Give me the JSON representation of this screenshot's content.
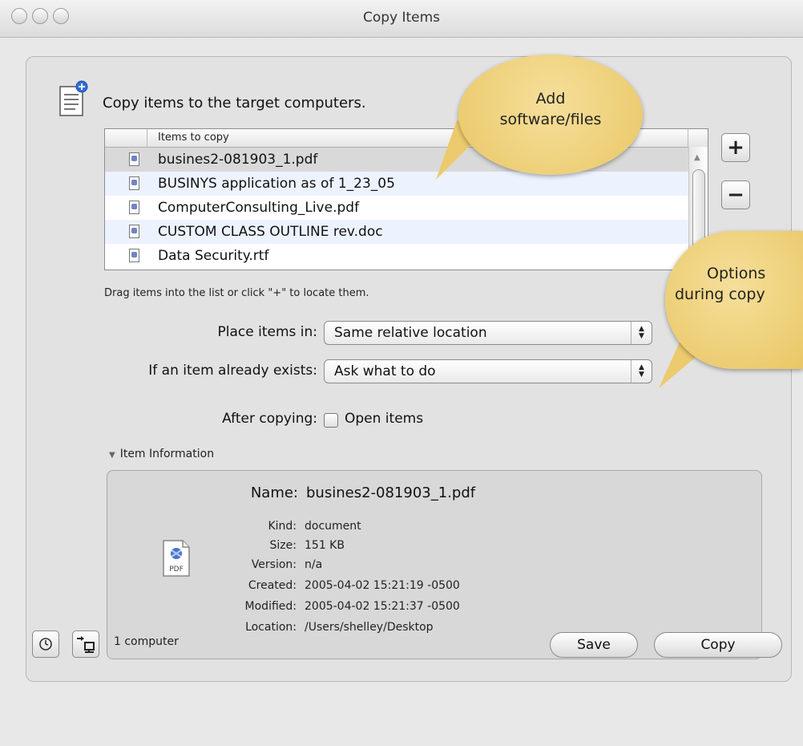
{
  "window": {
    "title": "Copy Items"
  },
  "header": {
    "heading": "Copy items to the target computers."
  },
  "items_list": {
    "column_header": "Items to copy",
    "rows": [
      {
        "name": "busines2-081903_1.pdf",
        "icon": "pdf-file-icon",
        "selected": true
      },
      {
        "name": "BUSINYS application as of 1_23_05",
        "icon": "pdf-file-icon",
        "selected": false
      },
      {
        "name": "ComputerConsulting_Live.pdf",
        "icon": "pdf-file-icon",
        "selected": false
      },
      {
        "name": "CUSTOM CLASS OUTLINE rev.doc",
        "icon": "doc-file-icon",
        "selected": false
      },
      {
        "name": "Data Security.rtf",
        "icon": "rtf-file-icon",
        "selected": false
      }
    ]
  },
  "list_buttons": {
    "add": "+",
    "remove": "−"
  },
  "hint": "Drag items into the list or click \"+\" to locate them.",
  "form": {
    "place_label": "Place items in:",
    "place_value": "Same relative location",
    "exists_label": "If an item already exists:",
    "exists_value": "Ask what to do",
    "after_label": "After copying:",
    "open_items_label": "Open items",
    "open_items_checked": false
  },
  "item_info": {
    "disclosure_label": "Item Information",
    "name_label": "Name:",
    "name_value": "busines2-081903_1.pdf",
    "kind_label": "Kind:",
    "kind_value": "document",
    "size_label": "Size:",
    "size_value": "151 KB",
    "version_label": "Version:",
    "version_value": "n/a",
    "created_label": "Created:",
    "created_value": "2005-04-02 15:21:19 -0500",
    "modified_label": "Modified:",
    "modified_value": "2005-04-02 15:21:37 -0500",
    "location_label": "Location:",
    "location_value": "/Users/shelley/Desktop",
    "icon_text": "PDF"
  },
  "footer": {
    "computer_count": "1 computer",
    "save_label": "Save",
    "copy_label": "Copy"
  },
  "callouts": {
    "add_text_line1": "Add",
    "add_text_line2": "software/files",
    "options_text_line1": "Options",
    "options_text_line2": "during copy"
  },
  "colors": {
    "callout": "#f0d37f",
    "selected_row": "#d9d9d9",
    "alt_row": "#edf3fe",
    "window_bg": "#e8e8e8"
  }
}
